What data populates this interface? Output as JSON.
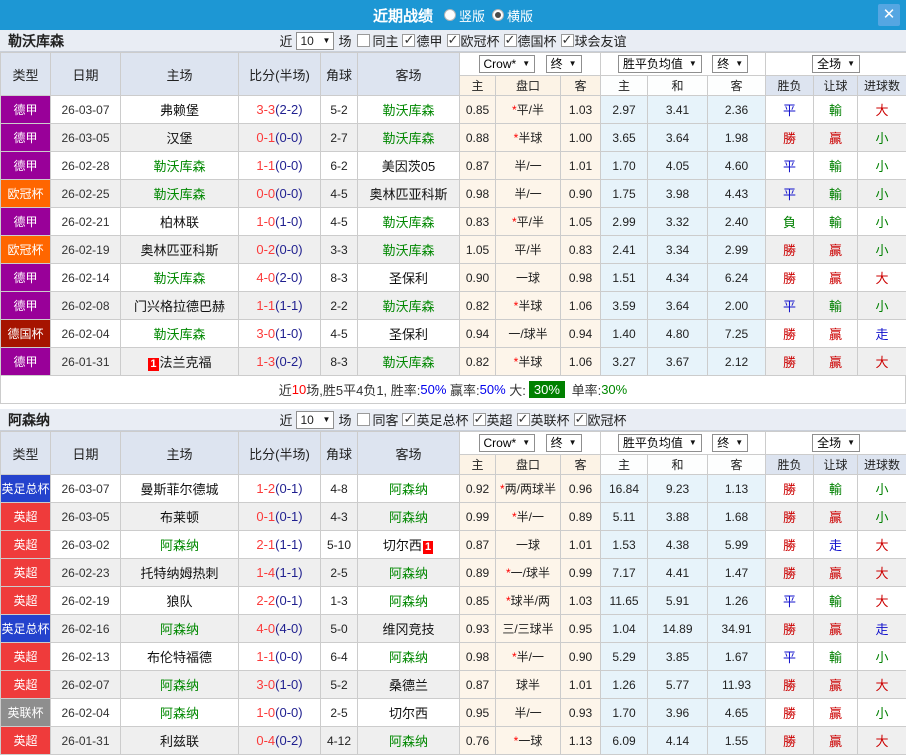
{
  "colors": {
    "topbar_bg": "#1d97d4",
    "close_bg": "#55a6e2",
    "header_bg": "#dde4f0",
    "section_bg": "#e9edf4",
    "odds_col_bg": "#fdf5ea",
    "mean_col_bg": "#e7f3fa",
    "zebra_bg": "#efefef",
    "score_full": "#fb3b3b",
    "score_half": "#1f1f8f",
    "win_red": "#cc0000",
    "draw_blue": "#1111cc",
    "lose_green": "#008000",
    "team_green": "#008800",
    "team_black": "#111111",
    "badge_red": "#fe0000",
    "bundesliga": "#990099",
    "ucl": "#ff6600",
    "dfb_pokal": "#a61400",
    "fa_cup": "#2442cd",
    "epl": "#ef3b3b",
    "efl_cup": "#8e8e8e"
  },
  "topbar": {
    "title": "近期战绩",
    "radios": [
      {
        "label": "竖版",
        "checked": false
      },
      {
        "label": "横版",
        "checked": true
      }
    ],
    "close": "✕"
  },
  "table_header": {
    "cols": [
      "类型",
      "日期",
      "主场",
      "比分(半场)",
      "角球",
      "客场"
    ],
    "odds_source": "Crow*",
    "final1": "终",
    "mean_label": "胜平负均值",
    "final2": "终",
    "scope": "全场",
    "arrow": "▼",
    "odds_sub": [
      "主",
      "盘口",
      "客"
    ],
    "mean_sub": [
      "主",
      "和",
      "客"
    ],
    "result_sub": [
      "胜负",
      "让球",
      "进球数"
    ]
  },
  "sections": {
    "lev": {
      "team": "勒沃库森",
      "near_label": "近",
      "games": "10",
      "games_suffix": "场",
      "same_label": "同主",
      "same_checked": false,
      "filters": [
        {
          "label": "德甲",
          "checked": true
        },
        {
          "label": "欧冠杯",
          "checked": true
        },
        {
          "label": "德国杯",
          "checked": true
        },
        {
          "label": "球会友谊",
          "checked": true
        }
      ],
      "rows": [
        {
          "league": "德甲",
          "league_bg": "#990099",
          "date": "26-03-07",
          "home": "弗赖堡",
          "home_color": "#111111",
          "home_badge": "",
          "score_full": "3-3",
          "score_half": "(2-2)",
          "corners": "5-2",
          "away": "勒沃库森",
          "away_color": "#008800",
          "away_badge": "",
          "odds_home": "0.85",
          "line_star": "*",
          "line": "平/半",
          "odds_away": "1.03",
          "mean_home": "2.97",
          "mean_draw": "3.41",
          "mean_away": "2.36",
          "wl": "平",
          "wl_color": "#1111cc",
          "let": "輸",
          "let_color": "#008000",
          "goal": "大",
          "goal_color": "#cc0000"
        },
        {
          "league": "德甲",
          "league_bg": "#990099",
          "date": "26-03-05",
          "home": "汉堡",
          "home_color": "#111111",
          "home_badge": "",
          "score_full": "0-1",
          "score_half": "(0-0)",
          "corners": "2-7",
          "away": "勒沃库森",
          "away_color": "#008800",
          "away_badge": "",
          "odds_home": "0.88",
          "line_star": "*",
          "line": "半球",
          "odds_away": "1.00",
          "mean_home": "3.65",
          "mean_draw": "3.64",
          "mean_away": "1.98",
          "wl": "勝",
          "wl_color": "#cc0000",
          "let": "贏",
          "let_color": "#cc0000",
          "goal": "小",
          "goal_color": "#008000"
        },
        {
          "league": "德甲",
          "league_bg": "#990099",
          "date": "26-02-28",
          "home": "勒沃库森",
          "home_color": "#008800",
          "home_badge": "",
          "score_full": "1-1",
          "score_half": "(0-0)",
          "corners": "6-2",
          "away": "美因茨05",
          "away_color": "#111111",
          "away_badge": "",
          "odds_home": "0.87",
          "line_star": "",
          "line": "半/一",
          "odds_away": "1.01",
          "mean_home": "1.70",
          "mean_draw": "4.05",
          "mean_away": "4.60",
          "wl": "平",
          "wl_color": "#1111cc",
          "let": "輸",
          "let_color": "#008000",
          "goal": "小",
          "goal_color": "#008000"
        },
        {
          "league": "欧冠杯",
          "league_bg": "#ff6600",
          "date": "26-02-25",
          "home": "勒沃库森",
          "home_color": "#008800",
          "home_badge": "",
          "score_full": "0-0",
          "score_half": "(0-0)",
          "corners": "4-5",
          "away": "奥林匹亚科斯",
          "away_color": "#111111",
          "away_badge": "",
          "odds_home": "0.98",
          "line_star": "",
          "line": "半/一",
          "odds_away": "0.90",
          "mean_home": "1.75",
          "mean_draw": "3.98",
          "mean_away": "4.43",
          "wl": "平",
          "wl_color": "#1111cc",
          "let": "輸",
          "let_color": "#008000",
          "goal": "小",
          "goal_color": "#008000"
        },
        {
          "league": "德甲",
          "league_bg": "#990099",
          "date": "26-02-21",
          "home": "柏林联",
          "home_color": "#111111",
          "home_badge": "",
          "score_full": "1-0",
          "score_half": "(1-0)",
          "corners": "4-5",
          "away": "勒沃库森",
          "away_color": "#008800",
          "away_badge": "",
          "odds_home": "0.83",
          "line_star": "*",
          "line": "平/半",
          "odds_away": "1.05",
          "mean_home": "2.99",
          "mean_draw": "3.32",
          "mean_away": "2.40",
          "wl": "負",
          "wl_color": "#008000",
          "let": "輸",
          "let_color": "#008000",
          "goal": "小",
          "goal_color": "#008000"
        },
        {
          "league": "欧冠杯",
          "league_bg": "#ff6600",
          "date": "26-02-19",
          "home": "奥林匹亚科斯",
          "home_color": "#111111",
          "home_badge": "",
          "score_full": "0-2",
          "score_half": "(0-0)",
          "corners": "3-3",
          "away": "勒沃库森",
          "away_color": "#008800",
          "away_badge": "",
          "odds_home": "1.05",
          "line_star": "",
          "line": "平/半",
          "odds_away": "0.83",
          "mean_home": "2.41",
          "mean_draw": "3.34",
          "mean_away": "2.99",
          "wl": "勝",
          "wl_color": "#cc0000",
          "let": "贏",
          "let_color": "#cc0000",
          "goal": "小",
          "goal_color": "#008000"
        },
        {
          "league": "德甲",
          "league_bg": "#990099",
          "date": "26-02-14",
          "home": "勒沃库森",
          "home_color": "#008800",
          "home_badge": "",
          "score_full": "4-0",
          "score_half": "(2-0)",
          "corners": "8-3",
          "away": "圣保利",
          "away_color": "#111111",
          "away_badge": "",
          "odds_home": "0.90",
          "line_star": "",
          "line": "一球",
          "odds_away": "0.98",
          "mean_home": "1.51",
          "mean_draw": "4.34",
          "mean_away": "6.24",
          "wl": "勝",
          "wl_color": "#cc0000",
          "let": "贏",
          "let_color": "#cc0000",
          "goal": "大",
          "goal_color": "#cc0000"
        },
        {
          "league": "德甲",
          "league_bg": "#990099",
          "date": "26-02-08",
          "home": "门兴格拉德巴赫",
          "home_color": "#111111",
          "home_badge": "",
          "score_full": "1-1",
          "score_half": "(1-1)",
          "corners": "2-2",
          "away": "勒沃库森",
          "away_color": "#008800",
          "away_badge": "",
          "odds_home": "0.82",
          "line_star": "*",
          "line": "半球",
          "odds_away": "1.06",
          "mean_home": "3.59",
          "mean_draw": "3.64",
          "mean_away": "2.00",
          "wl": "平",
          "wl_color": "#1111cc",
          "let": "輸",
          "let_color": "#008000",
          "goal": "小",
          "goal_color": "#008000"
        },
        {
          "league": "德国杯",
          "league_bg": "#a61400",
          "date": "26-02-04",
          "home": "勒沃库森",
          "home_color": "#008800",
          "home_badge": "",
          "score_full": "3-0",
          "score_half": "(1-0)",
          "corners": "4-5",
          "away": "圣保利",
          "away_color": "#111111",
          "away_badge": "",
          "odds_home": "0.94",
          "line_star": "",
          "line": "一/球半",
          "odds_away": "0.94",
          "mean_home": "1.40",
          "mean_draw": "4.80",
          "mean_away": "7.25",
          "wl": "勝",
          "wl_color": "#cc0000",
          "let": "贏",
          "let_color": "#cc0000",
          "goal": "走",
          "goal_color": "#1111cc"
        },
        {
          "league": "德甲",
          "league_bg": "#990099",
          "date": "26-01-31",
          "home": "法兰克福",
          "home_color": "#111111",
          "home_badge": "1",
          "score_full": "1-3",
          "score_half": "(0-2)",
          "corners": "8-3",
          "away": "勒沃库森",
          "away_color": "#008800",
          "away_badge": "",
          "odds_home": "0.82",
          "line_star": "*",
          "line": "半球",
          "odds_away": "1.06",
          "mean_home": "3.27",
          "mean_draw": "3.67",
          "mean_away": "2.12",
          "wl": "勝",
          "wl_color": "#cc0000",
          "let": "贏",
          "let_color": "#cc0000",
          "goal": "大",
          "goal_color": "#cc0000"
        }
      ],
      "summary": [
        {
          "text": "近",
          "color": "#333333",
          "bg": ""
        },
        {
          "text": "10",
          "color": "#ff0000",
          "bg": ""
        },
        {
          "text": "场,胜5平4负1, 胜率:",
          "color": "#333333",
          "bg": ""
        },
        {
          "text": "50%",
          "color": "#0000ee",
          "bg": ""
        },
        {
          "text": " 赢率:",
          "color": "#333333",
          "bg": ""
        },
        {
          "text": "50%",
          "color": "#0000ee",
          "bg": ""
        },
        {
          "text": " 大:",
          "color": "#333333",
          "bg": ""
        },
        {
          "text": "30%",
          "color": "#ffffff",
          "bg": "#008000"
        },
        {
          "text": " 单率:",
          "color": "#333333",
          "bg": ""
        },
        {
          "text": "30%",
          "color": "#008800",
          "bg": ""
        }
      ]
    },
    "ars": {
      "team": "阿森纳",
      "near_label": "近",
      "games": "10",
      "games_suffix": "场",
      "same_label": "同客",
      "same_checked": false,
      "filters": [
        {
          "label": "英足总杯",
          "checked": true
        },
        {
          "label": "英超",
          "checked": true
        },
        {
          "label": "英联杯",
          "checked": true
        },
        {
          "label": "欧冠杯",
          "checked": true
        }
      ],
      "rows": [
        {
          "league": "英足总杯",
          "league_bg": "#2442cd",
          "date": "26-03-07",
          "home": "曼斯菲尔德城",
          "home_color": "#111111",
          "home_badge": "",
          "score_full": "1-2",
          "score_half": "(0-1)",
          "corners": "4-8",
          "away": "阿森纳",
          "away_color": "#008800",
          "away_badge": "",
          "odds_home": "0.92",
          "line_star": "*",
          "line": "两/两球半",
          "odds_away": "0.96",
          "mean_home": "16.84",
          "mean_draw": "9.23",
          "mean_away": "1.13",
          "wl": "勝",
          "wl_color": "#cc0000",
          "let": "輸",
          "let_color": "#008000",
          "goal": "小",
          "goal_color": "#008000"
        },
        {
          "league": "英超",
          "league_bg": "#ef3b3b",
          "date": "26-03-05",
          "home": "布莱顿",
          "home_color": "#111111",
          "home_badge": "",
          "score_full": "0-1",
          "score_half": "(0-1)",
          "corners": "4-3",
          "away": "阿森纳",
          "away_color": "#008800",
          "away_badge": "",
          "odds_home": "0.99",
          "line_star": "*",
          "line": "半/一",
          "odds_away": "0.89",
          "mean_home": "5.11",
          "mean_draw": "3.88",
          "mean_away": "1.68",
          "wl": "勝",
          "wl_color": "#cc0000",
          "let": "贏",
          "let_color": "#cc0000",
          "goal": "小",
          "goal_color": "#008000"
        },
        {
          "league": "英超",
          "league_bg": "#ef3b3b",
          "date": "26-03-02",
          "home": "阿森纳",
          "home_color": "#008800",
          "home_badge": "",
          "score_full": "2-1",
          "score_half": "(1-1)",
          "corners": "5-10",
          "away": "切尔西",
          "away_color": "#111111",
          "away_badge": "1",
          "odds_home": "0.87",
          "line_star": "",
          "line": "一球",
          "odds_away": "1.01",
          "mean_home": "1.53",
          "mean_draw": "4.38",
          "mean_away": "5.99",
          "wl": "勝",
          "wl_color": "#cc0000",
          "let": "走",
          "let_color": "#1111cc",
          "goal": "大",
          "goal_color": "#cc0000"
        },
        {
          "league": "英超",
          "league_bg": "#ef3b3b",
          "date": "26-02-23",
          "home": "托特纳姆热刺",
          "home_color": "#111111",
          "home_badge": "",
          "score_full": "1-4",
          "score_half": "(1-1)",
          "corners": "2-5",
          "away": "阿森纳",
          "away_color": "#008800",
          "away_badge": "",
          "odds_home": "0.89",
          "line_star": "*",
          "line": "一/球半",
          "odds_away": "0.99",
          "mean_home": "7.17",
          "mean_draw": "4.41",
          "mean_away": "1.47",
          "wl": "勝",
          "wl_color": "#cc0000",
          "let": "贏",
          "let_color": "#cc0000",
          "goal": "大",
          "goal_color": "#cc0000"
        },
        {
          "league": "英超",
          "league_bg": "#ef3b3b",
          "date": "26-02-19",
          "home": "狼队",
          "home_color": "#111111",
          "home_badge": "",
          "score_full": "2-2",
          "score_half": "(0-1)",
          "corners": "1-3",
          "away": "阿森纳",
          "away_color": "#008800",
          "away_badge": "",
          "odds_home": "0.85",
          "line_star": "*",
          "line": "球半/两",
          "odds_away": "1.03",
          "mean_home": "11.65",
          "mean_draw": "5.91",
          "mean_away": "1.26",
          "wl": "平",
          "wl_color": "#1111cc",
          "let": "輸",
          "let_color": "#008000",
          "goal": "大",
          "goal_color": "#cc0000"
        },
        {
          "league": "英足总杯",
          "league_bg": "#2442cd",
          "date": "26-02-16",
          "home": "阿森纳",
          "home_color": "#008800",
          "home_badge": "",
          "score_full": "4-0",
          "score_half": "(4-0)",
          "corners": "5-0",
          "away": "维冈竞技",
          "away_color": "#111111",
          "away_badge": "",
          "odds_home": "0.93",
          "line_star": "",
          "line": "三/三球半",
          "odds_away": "0.95",
          "mean_home": "1.04",
          "mean_draw": "14.89",
          "mean_away": "34.91",
          "wl": "勝",
          "wl_color": "#cc0000",
          "let": "贏",
          "let_color": "#cc0000",
          "goal": "走",
          "goal_color": "#1111cc"
        },
        {
          "league": "英超",
          "league_bg": "#ef3b3b",
          "date": "26-02-13",
          "home": "布伦特福德",
          "home_color": "#111111",
          "home_badge": "",
          "score_full": "1-1",
          "score_half": "(0-0)",
          "corners": "6-4",
          "away": "阿森纳",
          "away_color": "#008800",
          "away_badge": "",
          "odds_home": "0.98",
          "line_star": "*",
          "line": "半/一",
          "odds_away": "0.90",
          "mean_home": "5.29",
          "mean_draw": "3.85",
          "mean_away": "1.67",
          "wl": "平",
          "wl_color": "#1111cc",
          "let": "輸",
          "let_color": "#008000",
          "goal": "小",
          "goal_color": "#008000"
        },
        {
          "league": "英超",
          "league_bg": "#ef3b3b",
          "date": "26-02-07",
          "home": "阿森纳",
          "home_color": "#008800",
          "home_badge": "",
          "score_full": "3-0",
          "score_half": "(1-0)",
          "corners": "5-2",
          "away": "桑德兰",
          "away_color": "#111111",
          "away_badge": "",
          "odds_home": "0.87",
          "line_star": "",
          "line": "球半",
          "odds_away": "1.01",
          "mean_home": "1.26",
          "mean_draw": "5.77",
          "mean_away": "11.93",
          "wl": "勝",
          "wl_color": "#cc0000",
          "let": "贏",
          "let_color": "#cc0000",
          "goal": "大",
          "goal_color": "#cc0000"
        },
        {
          "league": "英联杯",
          "league_bg": "#8e8e8e",
          "date": "26-02-04",
          "home": "阿森纳",
          "home_color": "#008800",
          "home_badge": "",
          "score_full": "1-0",
          "score_half": "(0-0)",
          "corners": "2-5",
          "away": "切尔西",
          "away_color": "#111111",
          "away_badge": "",
          "odds_home": "0.95",
          "line_star": "",
          "line": "半/一",
          "odds_away": "0.93",
          "mean_home": "1.70",
          "mean_draw": "3.96",
          "mean_away": "4.65",
          "wl": "勝",
          "wl_color": "#cc0000",
          "let": "贏",
          "let_color": "#cc0000",
          "goal": "小",
          "goal_color": "#008000"
        },
        {
          "league": "英超",
          "league_bg": "#ef3b3b",
          "date": "26-01-31",
          "home": "利兹联",
          "home_color": "#111111",
          "home_badge": "",
          "score_full": "0-4",
          "score_half": "(0-2)",
          "corners": "4-12",
          "away": "阿森纳",
          "away_color": "#008800",
          "away_badge": "",
          "odds_home": "0.76",
          "line_star": "*",
          "line": "一球",
          "odds_away": "1.13",
          "mean_home": "6.09",
          "mean_draw": "4.14",
          "mean_away": "1.55",
          "wl": "勝",
          "wl_color": "#cc0000",
          "let": "贏",
          "let_color": "#cc0000",
          "goal": "大",
          "goal_color": "#cc0000"
        }
      ]
    }
  }
}
